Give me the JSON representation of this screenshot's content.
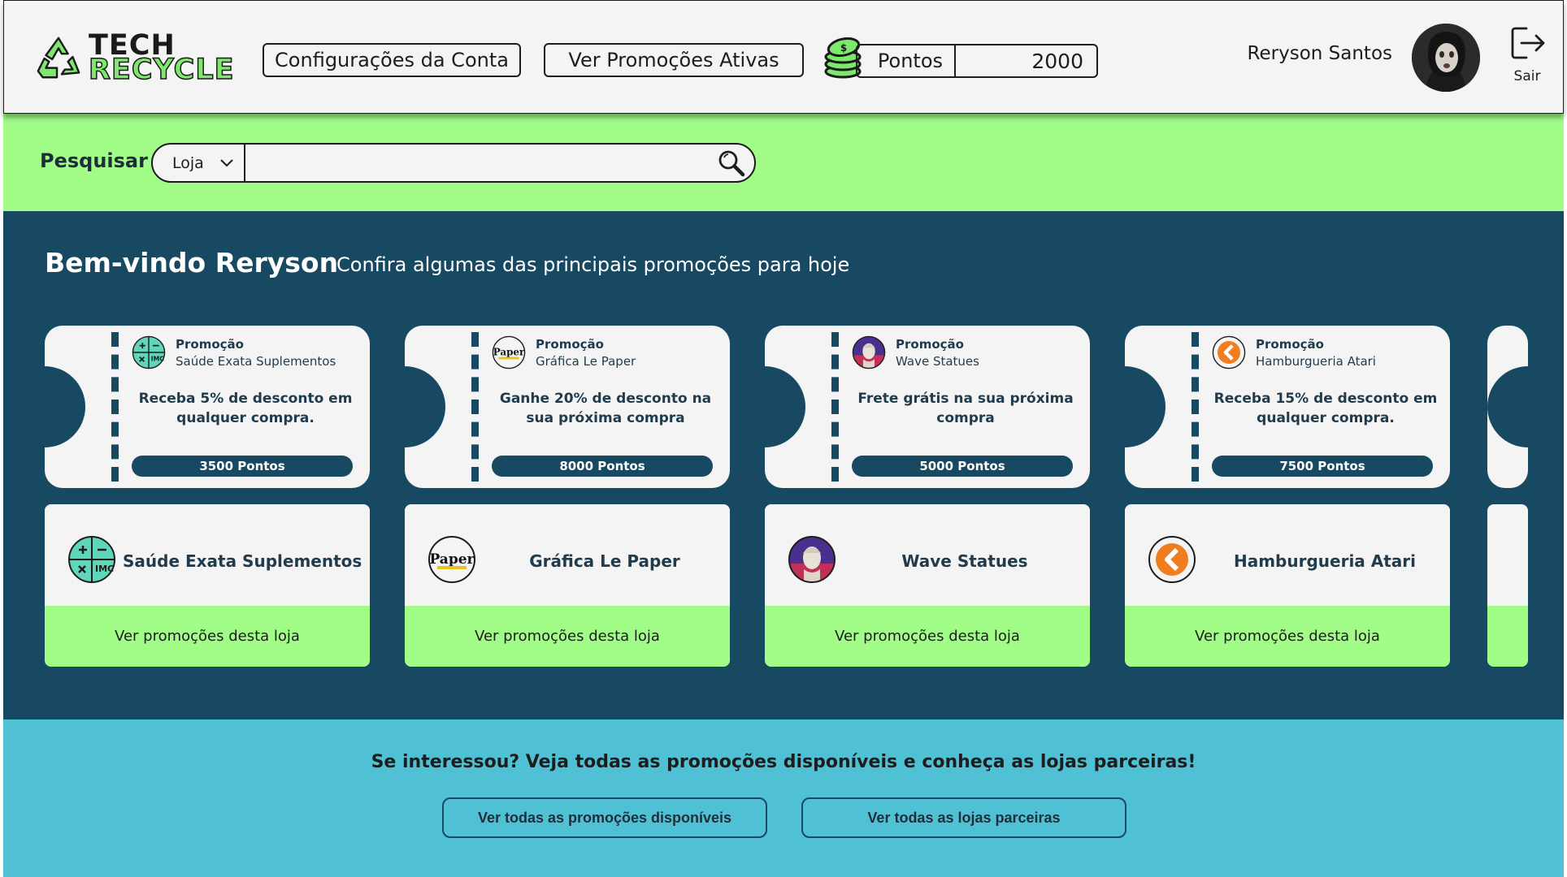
{
  "header": {
    "logo_top": "TECH",
    "logo_bottom": "RECYCLE",
    "account_settings_label": "Configurações da Conta",
    "active_promotions_label": "Ver Promoções Ativas",
    "points_label": "Pontos",
    "points_value": "2000",
    "user_name": "Reryson Santos",
    "logout_label": "Sair"
  },
  "search": {
    "label": "Pesquisar",
    "filter_selected": "Loja",
    "query_value": ""
  },
  "main": {
    "welcome": "Bem-vindo Reryson",
    "subtitle": "Confira algumas das principais promoções para hoje",
    "coupons": [
      {
        "kind": "Promoção",
        "store": "Saúde Exata Suplementos",
        "text": "Receba 5% de desconto em qualquer compra.",
        "points": "3500 Pontos",
        "logo": "imc-logo-icon"
      },
      {
        "kind": "Promoção",
        "store": "Gráfica Le Paper",
        "text": "Ganhe 20% de desconto na sua próxima compra",
        "points": "8000 Pontos",
        "logo": "paper-logo-icon"
      },
      {
        "kind": "Promoção",
        "store": "Wave Statues",
        "text": "Frete grátis na sua próxima compra",
        "points": "5000 Pontos",
        "logo": "statue-logo-icon"
      },
      {
        "kind": "Promoção",
        "store": "Hamburgueria Atari",
        "text": "Receba 15% de desconto em qualquer compra.",
        "points": "7500 Pontos",
        "logo": "atari-logo-icon"
      }
    ],
    "stores": [
      {
        "name": "Saúde Exata Suplementos",
        "action": "Ver promoções desta loja"
      },
      {
        "name": "Gráfica Le Paper",
        "action": "Ver promoções desta loja"
      },
      {
        "name": "Wave Statues",
        "action": "Ver promoções desta loja"
      },
      {
        "name": "Hamburgueria Atari",
        "action": "Ver promoções desta loja"
      }
    ]
  },
  "footer": {
    "text": "Se interessou? Veja todas as promoções disponíveis e conheça as lojas parceiras!",
    "all_promotions_label": "Ver todas as promoções disponíveis",
    "all_stores_label": "Ver todas as lojas parceiras"
  },
  "colors": {
    "header_bg": "#f4f4f4",
    "search_band": "#a1fd87",
    "main_bg": "#174962",
    "footer_bg": "#50c1d4",
    "text_dark": "#1f3b4d"
  }
}
